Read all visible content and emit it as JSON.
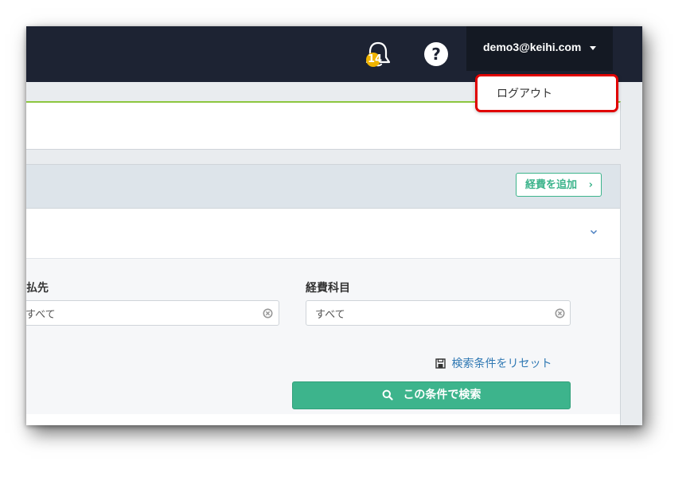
{
  "navbar": {
    "notification_count": "14",
    "help_label": "?",
    "user_email": "demo3@keihi.com"
  },
  "user_menu": {
    "logout_label": "ログアウト"
  },
  "expense_panel": {
    "add_button_label": "経費を追加",
    "add_button_chevron": "›"
  },
  "filters": {
    "payee": {
      "label": "払先",
      "value": "すべて"
    },
    "category": {
      "label": "経費科目",
      "value": "すべて"
    },
    "reset_label": "検索条件をリセット",
    "search_button_label": "この条件で検索"
  },
  "colors": {
    "navbar": "#1d2333",
    "accent": "#3db48c",
    "link": "#2f78b3",
    "highlight_outline": "#e00000",
    "badge": "#f0b400"
  }
}
